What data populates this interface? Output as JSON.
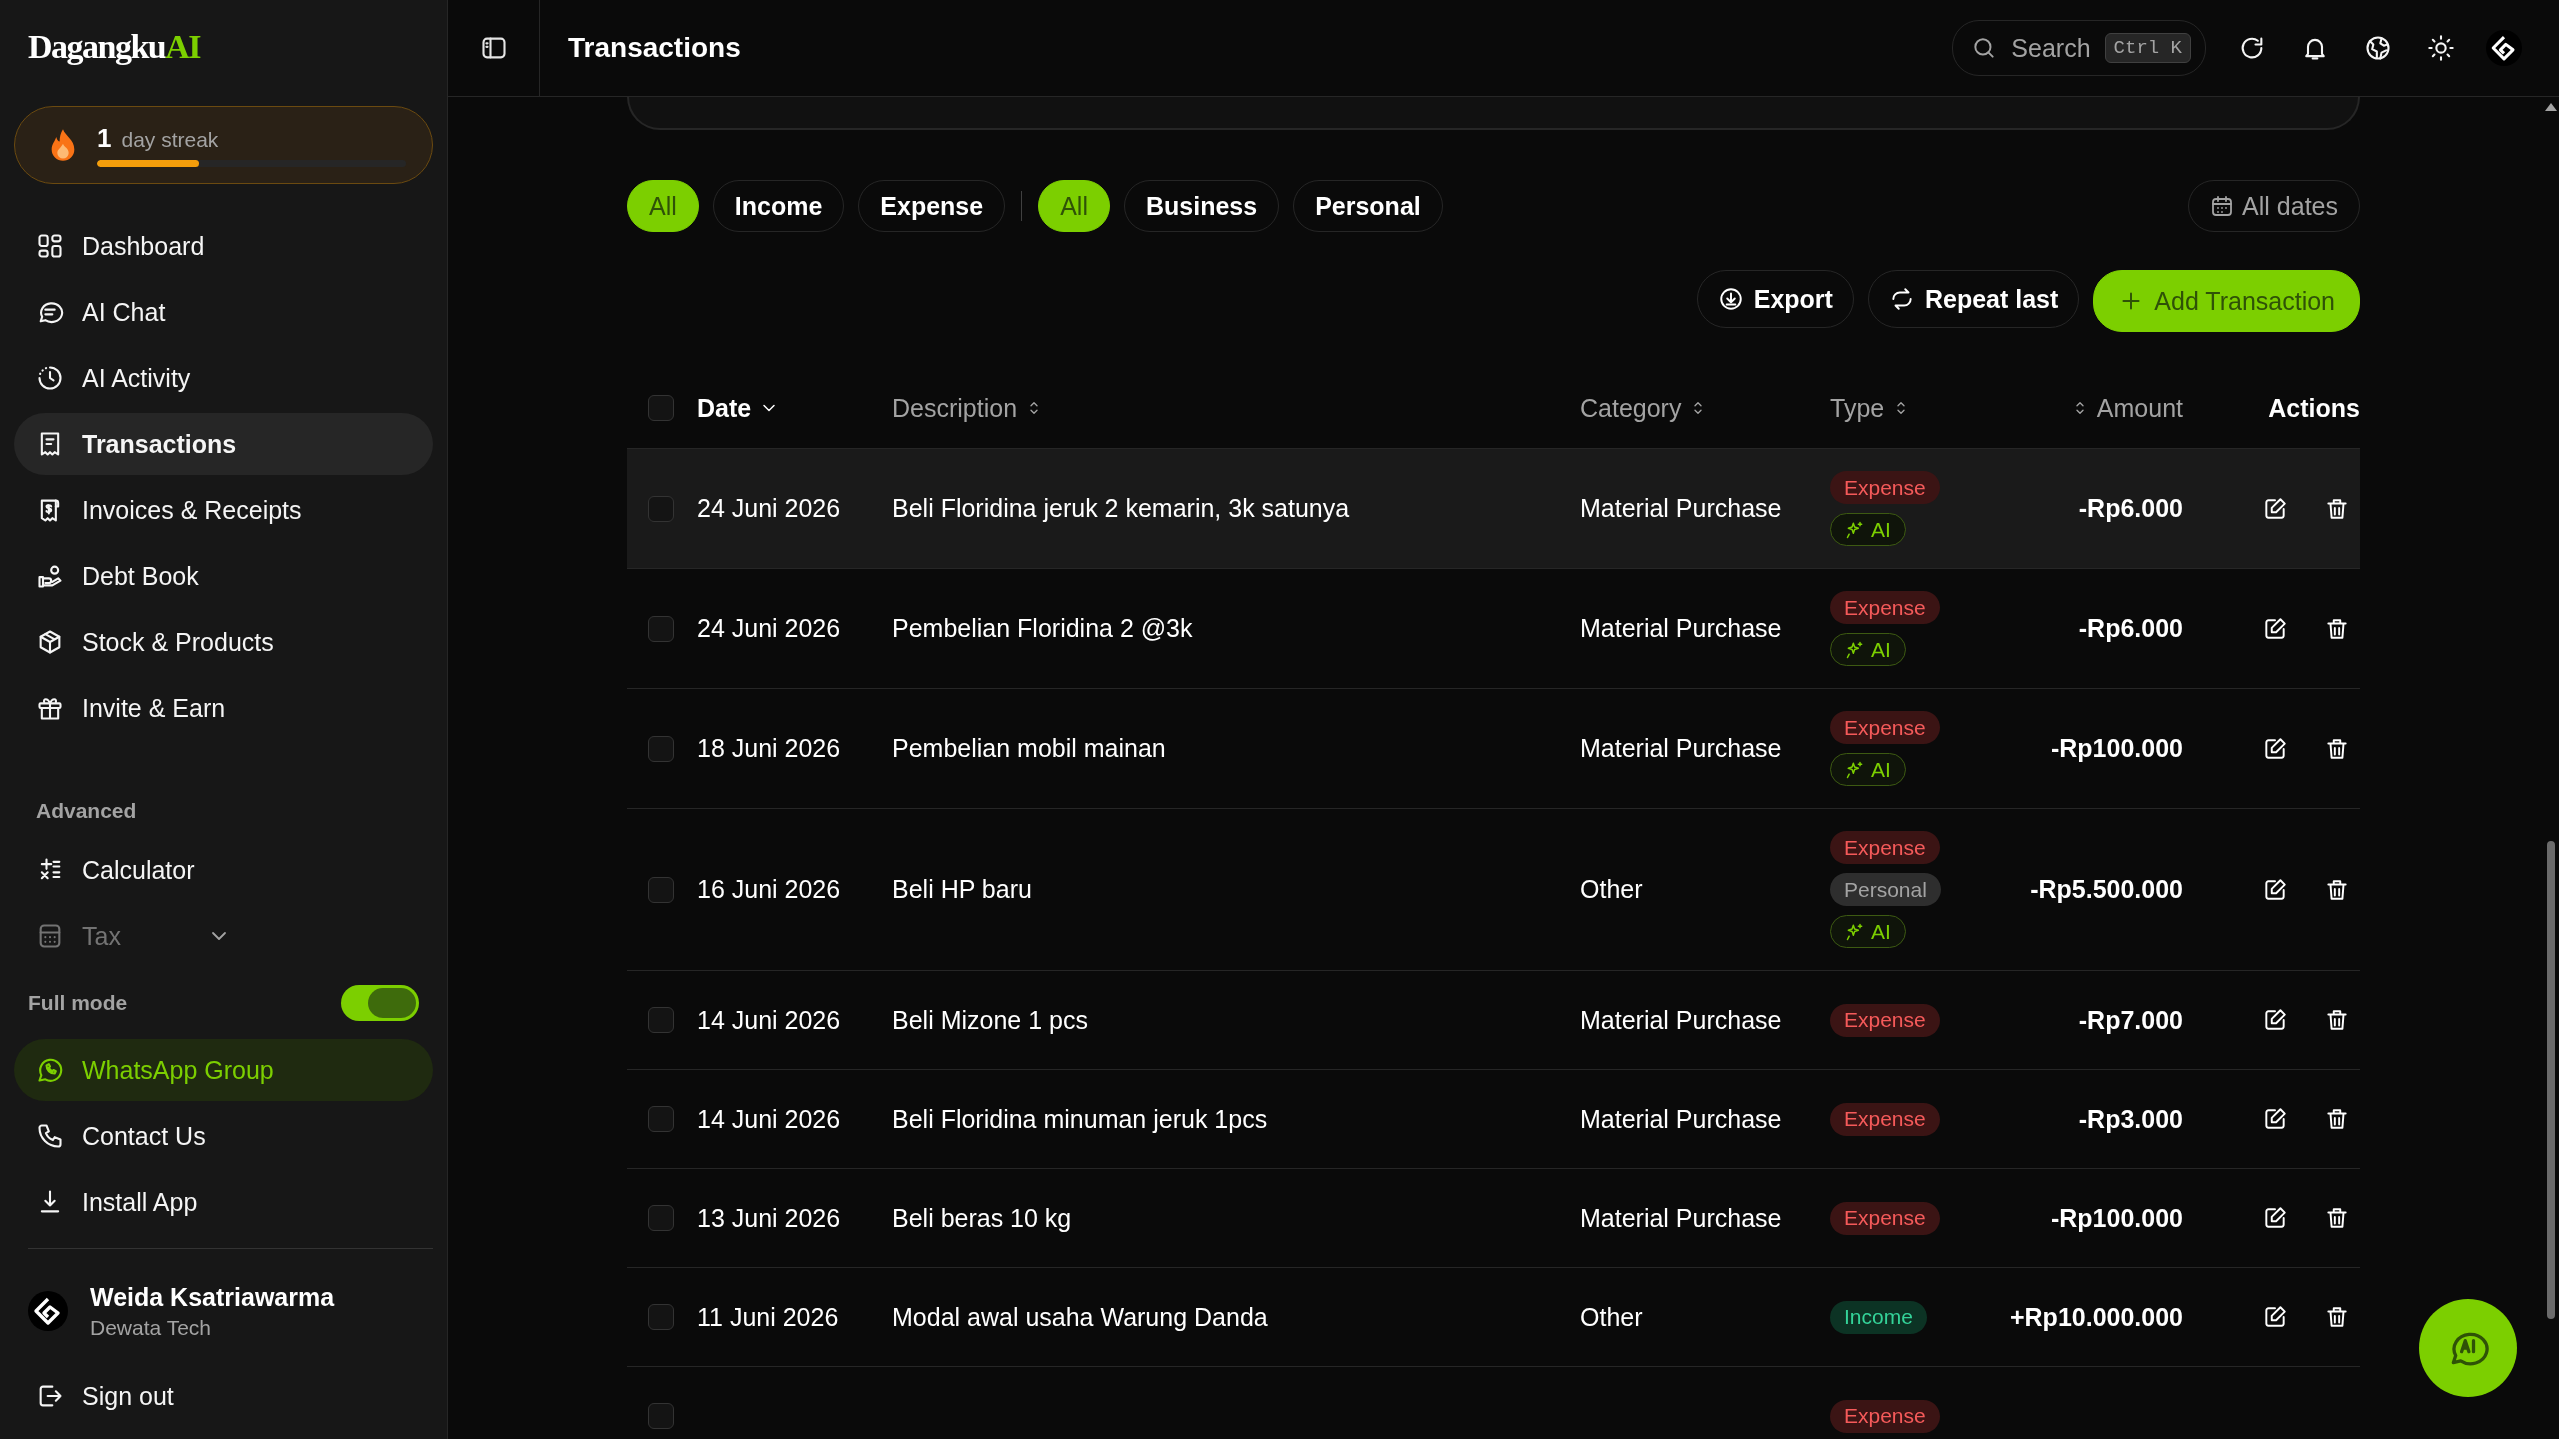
{
  "sidebar": {
    "logo": {
      "text": "Dagangku",
      "accent": "AI"
    },
    "streak": {
      "count": "1",
      "label": "day streak",
      "level": 0.33
    },
    "nav": [
      {
        "label": "Dashboard",
        "selected": false
      },
      {
        "label": "AI Chat",
        "selected": false
      },
      {
        "label": "AI Activity",
        "selected": false
      },
      {
        "label": "Transactions",
        "selected": true
      },
      {
        "label": "Invoices & Receipts",
        "selected": false
      },
      {
        "label": "Debt Book",
        "selected": false
      },
      {
        "label": "Stock & Products",
        "selected": false
      },
      {
        "label": "Invite & Earn",
        "selected": false
      }
    ],
    "section_label": "Advanced",
    "advanced": [
      {
        "label": "Calculator",
        "kind": "link",
        "disabled": false
      },
      {
        "label": "Tax",
        "kind": "group",
        "disabled": true
      }
    ],
    "full_mode": {
      "label": "Full mode",
      "on": true
    },
    "links": [
      {
        "label": "WhatsApp Group",
        "kind": "highlight"
      },
      {
        "label": "Contact Us",
        "kind": "link"
      },
      {
        "label": "Install App",
        "kind": "link"
      }
    ],
    "user": {
      "name": "Weida Ksatriawarma",
      "company": "Dewata Tech"
    },
    "sign_out": "Sign out"
  },
  "header": {
    "title": "Transactions",
    "search": {
      "placeholder": "Search",
      "shortcut": "Ctrl K"
    }
  },
  "filters": {
    "type": [
      {
        "label": "All",
        "selected": true
      },
      {
        "label": "Income",
        "selected": false
      },
      {
        "label": "Expense",
        "selected": false
      }
    ],
    "scope": [
      {
        "label": "All",
        "selected": true
      },
      {
        "label": "Business",
        "selected": false
      },
      {
        "label": "Personal",
        "selected": false
      }
    ],
    "date": "All dates"
  },
  "actions": [
    {
      "label": "Export",
      "kind": "export"
    },
    {
      "label": "Repeat last",
      "kind": "repeat"
    },
    {
      "label": "Add Transaction",
      "kind": "add"
    }
  ],
  "table": {
    "select_all": {
      "checked": false
    },
    "columns": [
      {
        "label": "Date",
        "sortable": true,
        "sorted": true
      },
      {
        "label": "Description",
        "sortable": true,
        "sorted": false
      },
      {
        "label": "Category",
        "sortable": true,
        "sorted": false
      },
      {
        "label": "Type",
        "sortable": true,
        "sorted": false
      },
      {
        "label": "Amount",
        "sortable": true,
        "sorted": false
      },
      {
        "label": "Actions",
        "sortable": false
      }
    ],
    "rows": [
      {
        "checked": false,
        "hovered": true,
        "date": "24 Juni 2026",
        "description": "Beli Floridina jeruk 2 kemarin, 3k satunya",
        "category": "Material Purchase",
        "badges": [
          {
            "kind": "expense",
            "text": "Expense"
          },
          {
            "kind": "ai",
            "text": "AI"
          }
        ],
        "amount": "-Rp6.000"
      },
      {
        "checked": false,
        "hovered": false,
        "date": "24 Juni 2026",
        "description": "Pembelian Floridina 2 @3k",
        "category": "Material Purchase",
        "badges": [
          {
            "kind": "expense",
            "text": "Expense"
          },
          {
            "kind": "ai",
            "text": "AI"
          }
        ],
        "amount": "-Rp6.000"
      },
      {
        "checked": false,
        "hovered": false,
        "date": "18 Juni 2026",
        "description": "Pembelian mobil mainan",
        "category": "Material Purchase",
        "badges": [
          {
            "kind": "expense",
            "text": "Expense"
          },
          {
            "kind": "ai",
            "text": "AI"
          }
        ],
        "amount": "-Rp100.000"
      },
      {
        "checked": false,
        "hovered": false,
        "date": "16 Juni 2026",
        "description": "Beli HP baru",
        "category": "Other",
        "badges": [
          {
            "kind": "expense",
            "text": "Expense"
          },
          {
            "kind": "personal",
            "text": "Personal"
          },
          {
            "kind": "ai",
            "text": "AI"
          }
        ],
        "amount": "-Rp5.500.000"
      },
      {
        "checked": false,
        "hovered": false,
        "date": "14 Juni 2026",
        "description": "Beli Mizone 1 pcs",
        "category": "Material Purchase",
        "badges": [
          {
            "kind": "expense",
            "text": "Expense"
          }
        ],
        "amount": "-Rp7.000"
      },
      {
        "checked": false,
        "hovered": false,
        "date": "14 Juni 2026",
        "description": "Beli Floridina minuman jeruk 1pcs",
        "category": "Material Purchase",
        "badges": [
          {
            "kind": "expense",
            "text": "Expense"
          }
        ],
        "amount": "-Rp3.000"
      },
      {
        "checked": false,
        "hovered": false,
        "date": "13 Juni 2026",
        "description": "Beli beras 10 kg",
        "category": "Material Purchase",
        "badges": [
          {
            "kind": "expense",
            "text": "Expense"
          }
        ],
        "amount": "-Rp100.000"
      },
      {
        "checked": false,
        "hovered": false,
        "date": "11 Juni 2026",
        "description": "Modal awal usaha Warung Danda",
        "category": "Other",
        "badges": [
          {
            "kind": "income",
            "text": "Income"
          }
        ],
        "amount": "+Rp10.000.000"
      },
      {
        "checked": false,
        "hovered": false,
        "badges": [
          {
            "kind": "expense",
            "text": "Expense"
          }
        ]
      }
    ]
  }
}
